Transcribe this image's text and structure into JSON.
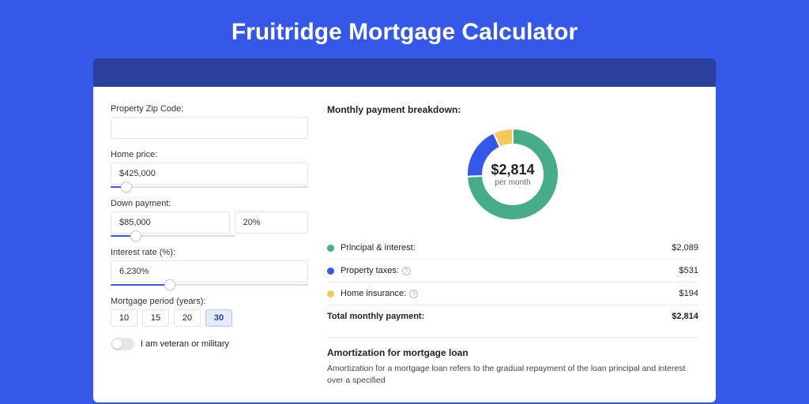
{
  "title": "Fruitridge Mortgage Calculator",
  "form": {
    "zip_label": "Property Zip Code:",
    "zip_value": "",
    "home_price_label": "Home price:",
    "home_price_value": "$425,000",
    "home_price_slider_pct": 8,
    "down_payment_label": "Down payment:",
    "down_payment_value": "$85,000",
    "down_payment_pct_value": "20%",
    "down_payment_slider_pct": 20,
    "interest_label": "Interest rate (%):",
    "interest_value": "6.230%",
    "interest_slider_pct": 30,
    "period_label": "Mortgage period (years):",
    "periods": [
      "10",
      "15",
      "20",
      "30"
    ],
    "period_active": "30",
    "veteran_label": "I am veteran or military"
  },
  "breakdown": {
    "heading": "Monthly payment breakdown:",
    "total_display": "$2,814",
    "per_month": "per month",
    "items": [
      {
        "label": "Principal & interest:",
        "value": "$2,089",
        "color": "#47ad89"
      },
      {
        "label": "Property taxes:",
        "value": "$531",
        "color": "#3658e8",
        "info": true
      },
      {
        "label": "Home insurance:",
        "value": "$194",
        "color": "#f4c95a",
        "info": true
      }
    ],
    "total_label": "Total monthly payment:",
    "total_value": "$2,814"
  },
  "amort": {
    "title": "Amortization for mortgage loan",
    "text": "Amortization for a mortgage loan refers to the gradual repayment of the loan principal and interest over a specified"
  },
  "chart_data": {
    "type": "pie",
    "title": "Monthly payment breakdown",
    "series": [
      {
        "name": "Principal & interest",
        "value": 2089,
        "color": "#47ad89"
      },
      {
        "name": "Property taxes",
        "value": 531,
        "color": "#3658e8"
      },
      {
        "name": "Home insurance",
        "value": 194,
        "color": "#f4c95a"
      }
    ],
    "total": 2814,
    "center_label": "$2,814 per month"
  }
}
